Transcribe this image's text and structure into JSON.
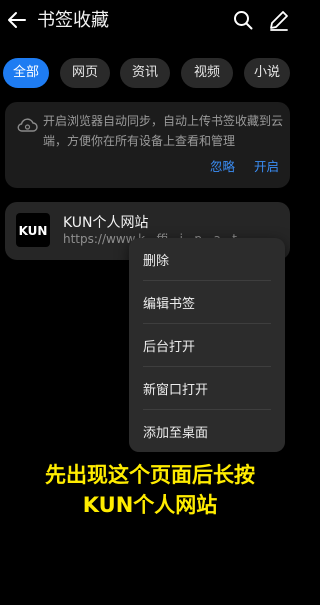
{
  "header": {
    "title": "书签收藏",
    "icons": [
      "back-arrow-icon",
      "search-icon",
      "edit-icon"
    ]
  },
  "tabs": [
    "全部",
    "网页",
    "资讯",
    "视频",
    "小说"
  ],
  "sync_card": {
    "text": "开启浏览器自动同步，自动上传书签收藏到云端，方便你在所有设备上查看和管理",
    "ignore": "忽略",
    "enable": "开启"
  },
  "bookmark": {
    "logo_text": "KUN",
    "title": "KUN个人网站",
    "url": "https://www.k...ffi...i...p...a...t"
  },
  "context_menu": [
    "删除",
    "编辑书签",
    "后台打开",
    "新窗口打开",
    "添加至桌面"
  ],
  "caption": {
    "line1": "先出现这个页面后长按",
    "line2": "KUN个人网站"
  },
  "colors": {
    "accent": "#1e7cf2",
    "link": "#3a8df5",
    "caption": "#ffec00"
  }
}
